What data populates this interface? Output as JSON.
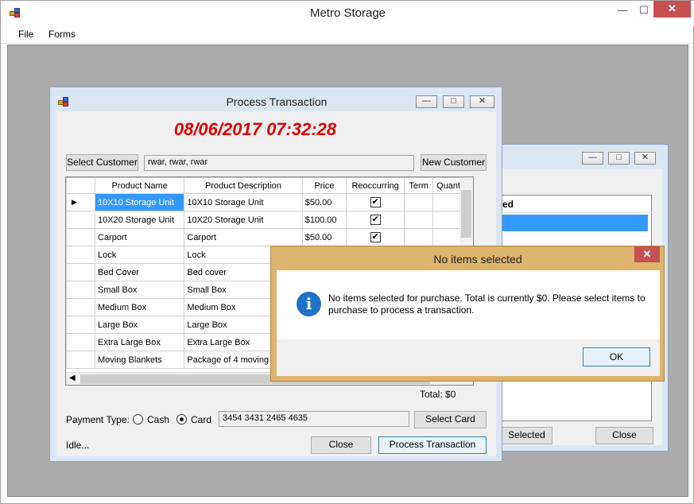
{
  "main_window": {
    "title": "Metro Storage",
    "menu": [
      "File",
      "Forms"
    ]
  },
  "background_window": {
    "grid_header": "ed",
    "selected_label": "Selected",
    "close_label": "Close"
  },
  "process_window": {
    "title": "Process Transaction",
    "datetime": "08/06/2017 07:32:28",
    "select_customer_label": "Select Customer",
    "customer_value": "rwar, rwar, rwar",
    "new_customer_label": "New Customer",
    "columns": [
      "Product Name",
      "Product Description",
      "Price",
      "Reoccurring",
      "Term",
      "Quantity"
    ],
    "rows": [
      {
        "name": "10X10 Storage Unit",
        "description": "10X10 Storage Unit",
        "price": "$50.00",
        "reoccurring": true
      },
      {
        "name": "10X20 Storage Unit",
        "description": "10X20 Storage Unit",
        "price": "$100.00",
        "reoccurring": true
      },
      {
        "name": "Carport",
        "description": "Carport",
        "price": "$50.00",
        "reoccurring": true
      },
      {
        "name": "Lock",
        "description": "Lock",
        "price": "",
        "reoccurring": false
      },
      {
        "name": "Bed Cover",
        "description": "Bed cover",
        "price": "",
        "reoccurring": false
      },
      {
        "name": "Small Box",
        "description": "Small Box",
        "price": "",
        "reoccurring": false
      },
      {
        "name": "Medium Box",
        "description": "Medium Box",
        "price": "",
        "reoccurring": false
      },
      {
        "name": "Large Box",
        "description": "Large Box",
        "price": "",
        "reoccurring": false
      },
      {
        "name": "Extra Large Box",
        "description": "Extra Large Box",
        "price": "",
        "reoccurring": false
      },
      {
        "name": "Moving Blankets",
        "description": "Package of 4 moving",
        "price": "",
        "reoccurring": false
      }
    ],
    "total_label": "Total:",
    "total_value": "$0",
    "payment_type_label": "Payment Type:",
    "cash_label": "Cash",
    "card_label": "Card",
    "selected_payment": "Card",
    "card_number": "3454 3431 2465 4635",
    "select_card_label": "Select Card",
    "status": "Idle...",
    "close_label": "Close",
    "process_label": "Process Transaction"
  },
  "dialog": {
    "title": "No items selected",
    "message": "No items selected for purchase. Total is currently $0. Please select items to purchase to process a transaction.",
    "ok_label": "OK",
    "icon": "info-icon"
  }
}
